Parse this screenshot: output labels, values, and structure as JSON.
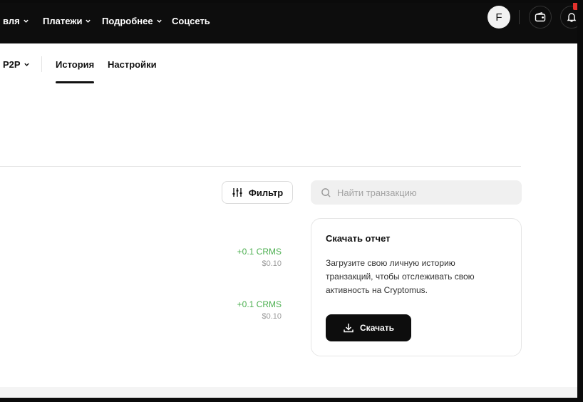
{
  "topnav": {
    "items": [
      {
        "label": "вля",
        "has_chevron": true
      },
      {
        "label": "Платежи",
        "has_chevron": true
      },
      {
        "label": "Подробнее",
        "has_chevron": true
      },
      {
        "label": "Соцсеть",
        "has_chevron": false
      }
    ],
    "avatar_letter": "F",
    "icons": [
      "wallet-icon",
      "bell-icon"
    ],
    "notification_color": "#e5322d"
  },
  "subnav": {
    "dropdown_label": "P2P",
    "tabs": [
      {
        "label": "История",
        "active": true
      },
      {
        "label": "Настройки",
        "active": false
      }
    ]
  },
  "toolbar": {
    "filter_label": "Фильтр",
    "search_placeholder": "Найти транзакцию"
  },
  "transactions": [
    {
      "amount": "+0.1 CRMS",
      "fiat": "$0.10"
    },
    {
      "amount": "+0.1 CRMS",
      "fiat": "$0.10"
    }
  ],
  "report_card": {
    "title": "Скачать отчет",
    "description": "Загрузите свою личную историю транзакций, чтобы отслеживать свою активность на Cryptomus.",
    "button_label": "Скачать"
  },
  "colors": {
    "positive": "#4caf50",
    "dark": "#0d0d0d",
    "accent_red": "#e5322d"
  }
}
